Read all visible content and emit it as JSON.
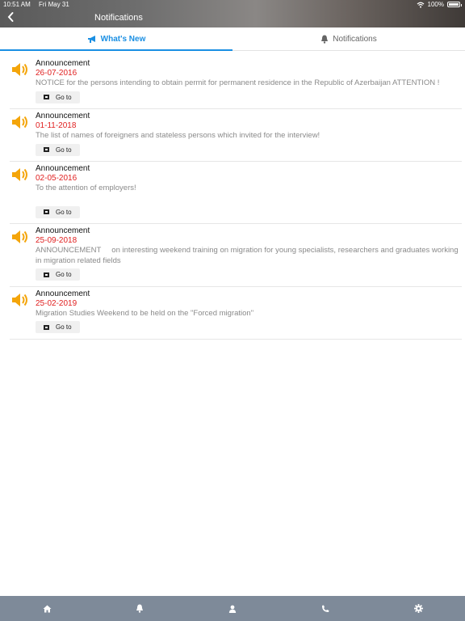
{
  "status": {
    "time": "10:51 AM",
    "date": "Fri May 31",
    "battery": "100%"
  },
  "header": {
    "title": "Notifications"
  },
  "tabs": [
    {
      "label": "What's New",
      "icon": "megaphone-icon",
      "active": true
    },
    {
      "label": "Notifications",
      "icon": "bell-icon",
      "active": false
    }
  ],
  "colors": {
    "accent": "#1a8fe3",
    "date": "#e02020",
    "speaker": "#f4a50a",
    "bottombar": "#7e8a99"
  },
  "items": [
    {
      "kind": "Announcement",
      "date": "26-07-2016",
      "text": "NOTICE for the persons intending to obtain permit for permanent residence in the Republic of Azerbaijan ATTENTION !",
      "button": "Go to"
    },
    {
      "kind": "Announcement",
      "date": "01-11-2018",
      "text": "The list of names of foreigners and stateless persons which invited for the interview!",
      "button": "Go to"
    },
    {
      "kind": "Announcement",
      "date": "02-05-2016",
      "text": "To the attention of employers!",
      "button": "Go to"
    },
    {
      "kind": "Announcement",
      "date": "25-09-2018",
      "text": "ANNOUNCEMENT     on interesting weekend training on migration for young specialists, researchers and graduates working in migration related fields",
      "button": "Go to"
    },
    {
      "kind": "Announcement",
      "date": "25-02-2019",
      "text": "Migration Studies Weekend to be held on the \"Forced migration\"",
      "button": "Go to"
    }
  ],
  "bottom_nav": [
    "home-icon",
    "bell-icon",
    "user-icon",
    "phone-icon",
    "settings-icon"
  ]
}
